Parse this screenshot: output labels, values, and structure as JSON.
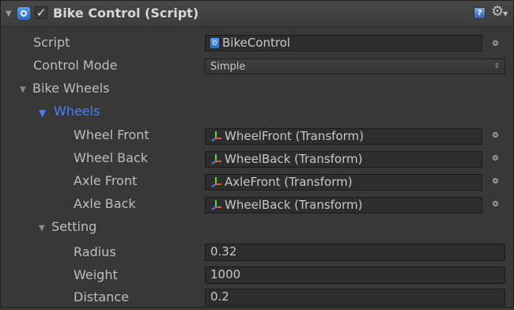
{
  "component": {
    "title": "Bike Control (Script)",
    "enabled": true
  },
  "script_row": {
    "label": "Script",
    "value": "BikeControl"
  },
  "control_mode_row": {
    "label": "Control Mode",
    "value": "Simple"
  },
  "bike_wheels": {
    "label": "Bike Wheels"
  },
  "wheels": {
    "label": "Wheels",
    "items": [
      {
        "label": "Wheel Front",
        "value": "WheelFront (Transform)"
      },
      {
        "label": "Wheel Back",
        "value": "WheelBack (Transform)"
      },
      {
        "label": "Axle Front",
        "value": "AxleFront (Transform)"
      },
      {
        "label": "Axle Back",
        "value": "WheelBack (Transform)"
      }
    ]
  },
  "setting": {
    "label": "Setting",
    "items": [
      {
        "label": "Radius",
        "value": "0.32"
      },
      {
        "label": "Weight",
        "value": "1000"
      },
      {
        "label": "Distance",
        "value": "0.2"
      }
    ]
  },
  "colors": {
    "accent": "#4d7dff",
    "panel": "#383838",
    "field": "#2d2d2d",
    "text": "#bdbdbd"
  }
}
